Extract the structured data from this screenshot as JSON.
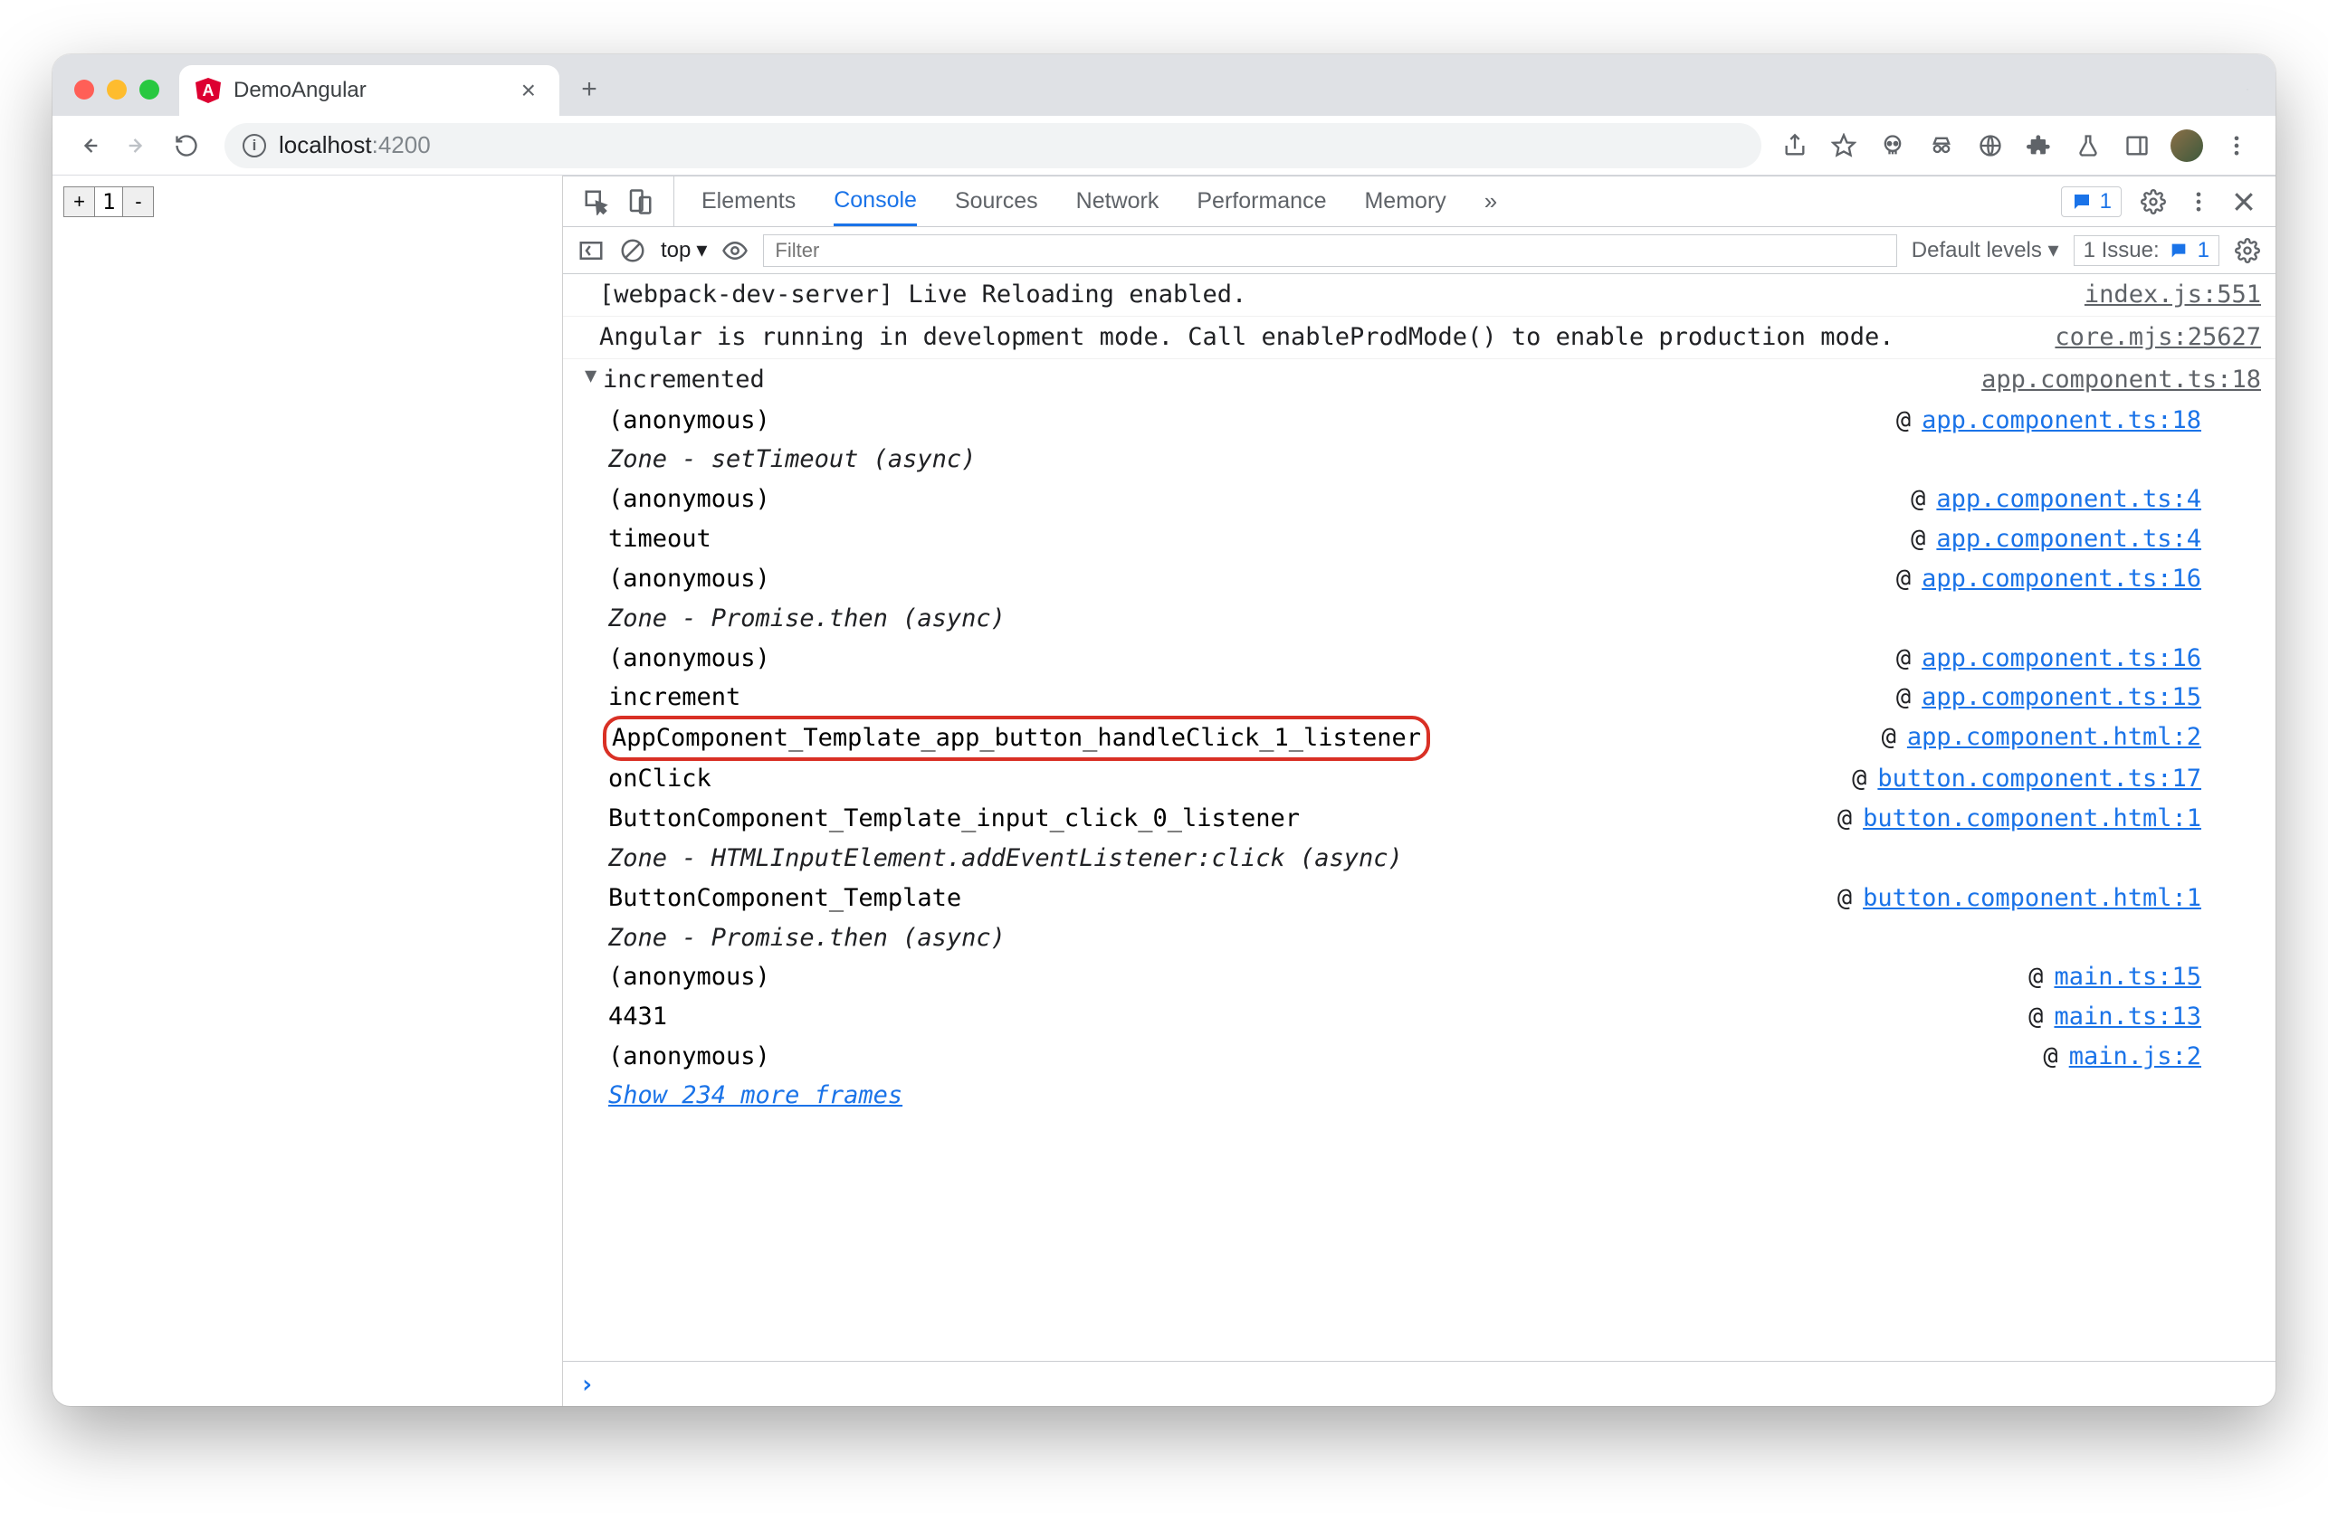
{
  "browser": {
    "tab_title": "DemoAngular",
    "url_host": "localhost",
    "url_port": ":4200"
  },
  "page": {
    "counter_value": "1"
  },
  "devtools": {
    "tabs": [
      "Elements",
      "Console",
      "Sources",
      "Network",
      "Performance",
      "Memory"
    ],
    "active_tab": "Console",
    "context": "top",
    "filter_placeholder": "Filter",
    "levels_label": "Default levels",
    "issues_label": "1 Issue:",
    "issues_count": "1",
    "chat_badge": "1"
  },
  "console": {
    "line1": {
      "text": "[webpack-dev-server] Live Reloading enabled.",
      "src": "index.js:551"
    },
    "line2": {
      "text": "Angular is running in development mode. Call enableProdMode() to enable production mode.",
      "src": "core.mjs:25627"
    },
    "group": {
      "header": "incremented",
      "src": "app.component.ts:18"
    },
    "stack": [
      {
        "name": "(anonymous)",
        "at": "app.component.ts:18"
      },
      {
        "zone": "Zone - setTimeout (async)"
      },
      {
        "name": "(anonymous)",
        "at": "app.component.ts:4"
      },
      {
        "name": "timeout",
        "at": "app.component.ts:4"
      },
      {
        "name": "(anonymous)",
        "at": "app.component.ts:16"
      },
      {
        "zone": "Zone - Promise.then (async)"
      },
      {
        "name": "(anonymous)",
        "at": "app.component.ts:16"
      },
      {
        "name": "increment",
        "at": "app.component.ts:15"
      },
      {
        "name": "AppComponent_Template_app_button_handleClick_1_listener",
        "at": "app.component.html:2",
        "highlight": true
      },
      {
        "name": "onClick",
        "at": "button.component.ts:17"
      },
      {
        "name": "ButtonComponent_Template_input_click_0_listener",
        "at": "button.component.html:1"
      },
      {
        "zone": "Zone - HTMLInputElement.addEventListener:click (async)"
      },
      {
        "name": "ButtonComponent_Template",
        "at": "button.component.html:1"
      },
      {
        "zone": "Zone - Promise.then (async)"
      },
      {
        "name": "(anonymous)",
        "at": "main.ts:15"
      },
      {
        "name": "4431",
        "at": "main.ts:13"
      },
      {
        "name": "(anonymous)",
        "at": "main.js:2"
      }
    ],
    "show_more": "Show 234 more frames"
  }
}
